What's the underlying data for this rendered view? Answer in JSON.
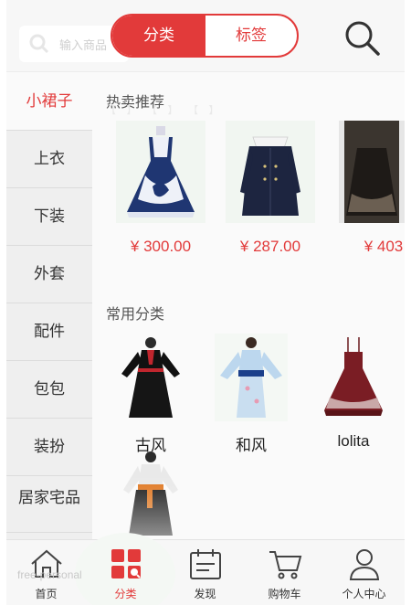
{
  "header": {
    "search_placeholder": "输入商品",
    "segments": [
      "分类",
      "标签"
    ],
    "active_segment": "分类"
  },
  "sidebar": {
    "items": [
      {
        "label": "小裙子",
        "active": true
      },
      {
        "label": "上衣"
      },
      {
        "label": "下装"
      },
      {
        "label": "外套"
      },
      {
        "label": "配件"
      },
      {
        "label": "包包"
      },
      {
        "label": "装扮"
      },
      {
        "label": "居家宅品"
      }
    ]
  },
  "hot": {
    "title": "热卖推荐",
    "items": [
      {
        "price": "¥ 300.00",
        "image": "navy-lolita-dress"
      },
      {
        "price": "¥ 287.00",
        "image": "navy-coat-with-collar"
      },
      {
        "price": "¥ 403",
        "image": "dark-lolita-dress"
      }
    ]
  },
  "categories": {
    "title": "常用分类",
    "items": [
      {
        "label": "古风",
        "image": "hanfu-red-black"
      },
      {
        "label": "和风",
        "image": "kimono-light-blue"
      },
      {
        "label": "lolita",
        "image": "red-lolita-jsk"
      },
      {
        "label": "",
        "image": "hanfu-black-orange"
      }
    ]
  },
  "tabbar": {
    "items": [
      {
        "label": "首页",
        "icon": "home-icon"
      },
      {
        "label": "分类",
        "icon": "category-icon",
        "active": true
      },
      {
        "label": "发现",
        "icon": "calendar-icon"
      },
      {
        "label": "购物车",
        "icon": "cart-icon"
      },
      {
        "label": "个人中心",
        "icon": "user-icon"
      }
    ]
  },
  "watermark": "free-personal",
  "colors": {
    "accent": "#e23a3a",
    "sidebar_bg": "#efefef",
    "page_bg": "#fafafa"
  }
}
